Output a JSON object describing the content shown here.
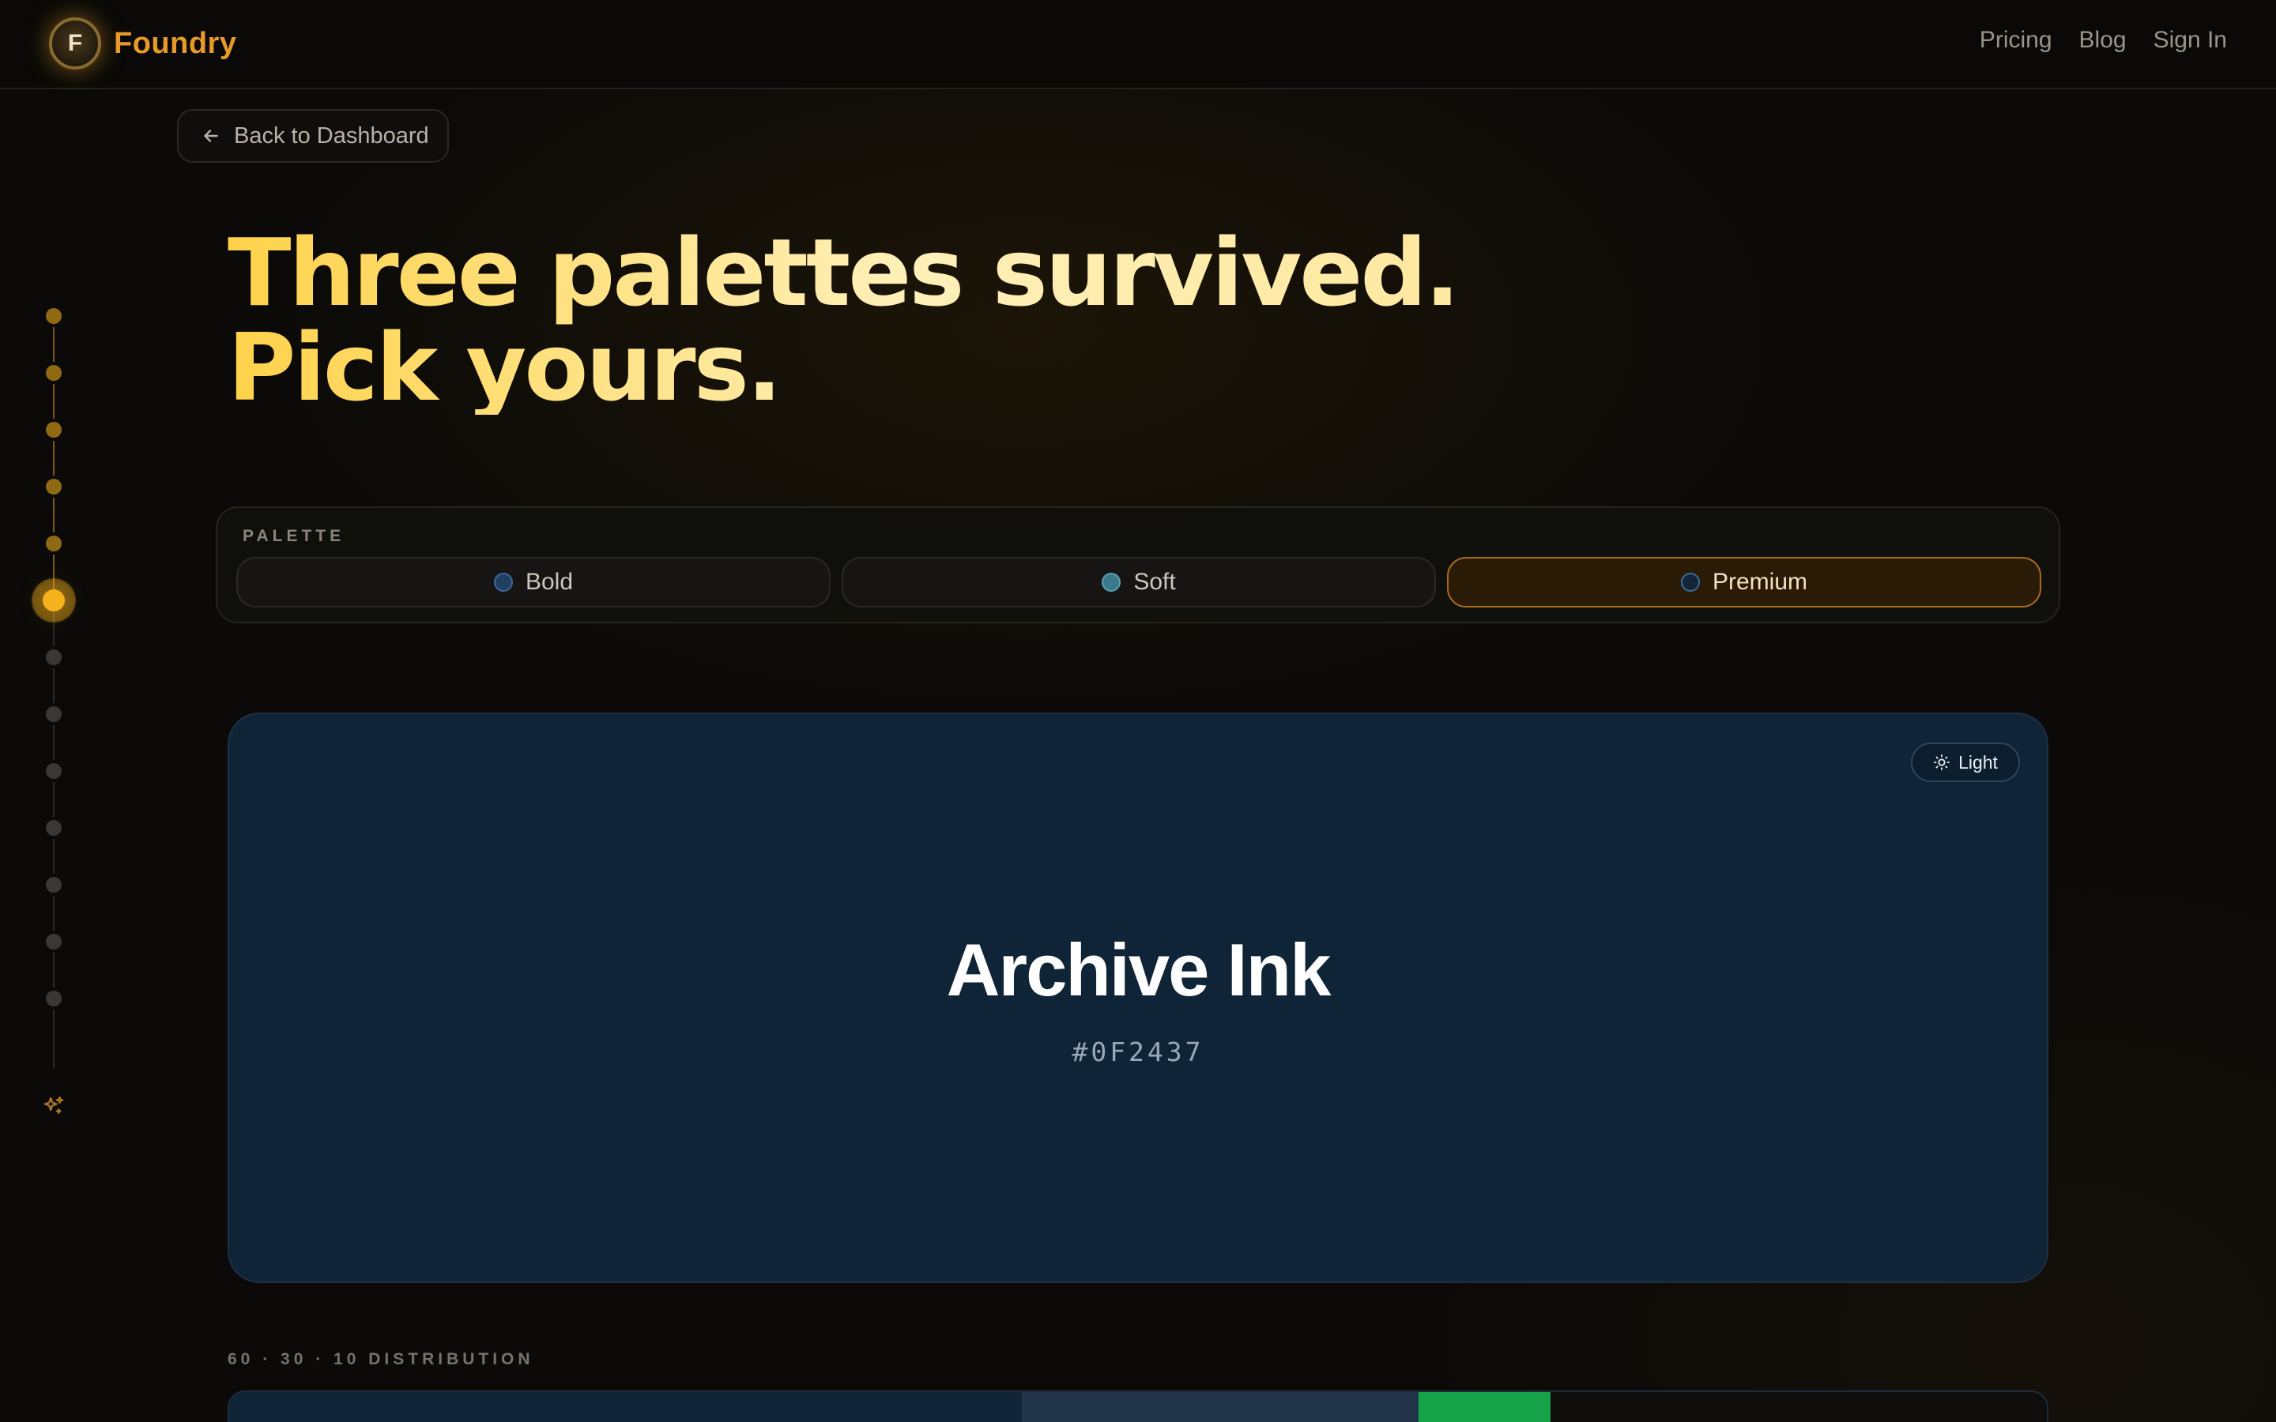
{
  "header": {
    "logo_letter": "F",
    "brand": "Foundry",
    "nav": [
      "Pricing",
      "Blog",
      "Sign In"
    ]
  },
  "back_button": {
    "label": "Back to Dashboard"
  },
  "stepper": {
    "total_steps": 13,
    "current_step": 6,
    "final_icon": "sparkles-icon"
  },
  "headline": {
    "line1": "Three palettes survived.",
    "line2": "Pick yours."
  },
  "palette_picker": {
    "label": "PALETTE",
    "options": [
      {
        "label": "Bold",
        "swatch": "#1f3f63",
        "active": false
      },
      {
        "label": "Soft",
        "swatch": "#3b7a8c",
        "active": false
      },
      {
        "label": "Premium",
        "swatch": "#14253a",
        "active": true
      }
    ]
  },
  "preview": {
    "mode_button": "Light",
    "mode_icon": "sun-icon",
    "color_name": "Archive Ink",
    "color_hex": "#0F2437",
    "background": "#0F2437"
  },
  "distribution": {
    "label": "60 · 30 · 10 DISTRIBUTION",
    "segments": [
      {
        "color": "#0F2437",
        "share": 0.6
      },
      {
        "color": "#22354b",
        "share": 0.3
      },
      {
        "color": "#16a34a",
        "share": 0.1
      }
    ]
  },
  "colors": {
    "accent": "#e79a2a",
    "active_step": "#f5b21c"
  }
}
